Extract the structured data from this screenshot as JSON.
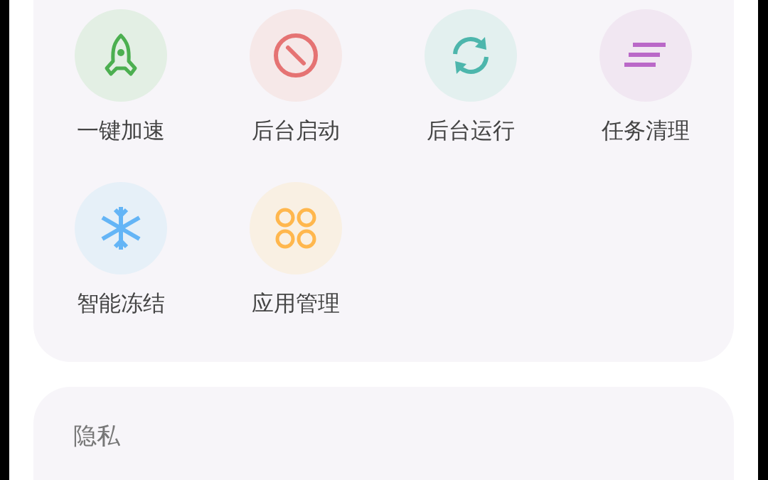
{
  "tools": {
    "items": [
      {
        "label": "一键加速",
        "kind": "rocket",
        "color": "#4caf50"
      },
      {
        "label": "后台启动",
        "kind": "block",
        "color": "#e57373"
      },
      {
        "label": "后台运行",
        "kind": "sync",
        "color": "#4db6ac"
      },
      {
        "label": "任务清理",
        "kind": "lines",
        "color": "#ba68c8"
      },
      {
        "label": "智能冻结",
        "kind": "snowflake",
        "color": "#64b5f6"
      },
      {
        "label": "应用管理",
        "kind": "apps",
        "color": "#ffb74d"
      }
    ]
  },
  "privacy": {
    "title": "隐私"
  }
}
